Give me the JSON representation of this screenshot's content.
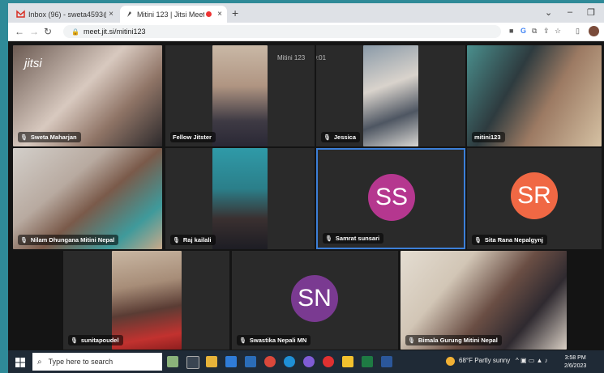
{
  "browser": {
    "tabs": [
      {
        "label": "Inbox (96) - sweta4593@gmail.c",
        "close": "×"
      },
      {
        "label": "Mitini 123 | Jitsi Meet",
        "close": "×"
      }
    ],
    "new_tab": "+",
    "url": "meet.jit.si/mitini123",
    "window_controls": [
      "⌄",
      "–"
    ]
  },
  "meeting": {
    "logo": "jitsi",
    "room_name": "Mitini 123",
    "timer": "59:01",
    "participants": [
      {
        "name": "Sweta Maharjan"
      },
      {
        "name": "Fellow Jitster"
      },
      {
        "name": "Jessica"
      },
      {
        "name": "mitini123"
      },
      {
        "name": "Nilam Dhungana Mitini Nepal"
      },
      {
        "name": "Raj kailali"
      },
      {
        "name": "Samrat sunsari",
        "initials": "SS"
      },
      {
        "name": "Sita Rana Nepalgynj",
        "initials": "SR"
      },
      {
        "name": "sunitapoudel"
      },
      {
        "name": "Swastika Nepali MN",
        "initials": "SN"
      },
      {
        "name": "Bimala Gurung Mitini Nepal"
      }
    ]
  },
  "taskbar": {
    "search_placeholder": "Type here to search",
    "weather": "68°F  Partly sunny",
    "time": "3:58 PM",
    "date": "2/6/2023"
  },
  "colors": {
    "avatar_ss": "#b5378f",
    "avatar_sr": "#f06844",
    "avatar_sn": "#7a3a91",
    "active_border": "#3c7fd8"
  }
}
